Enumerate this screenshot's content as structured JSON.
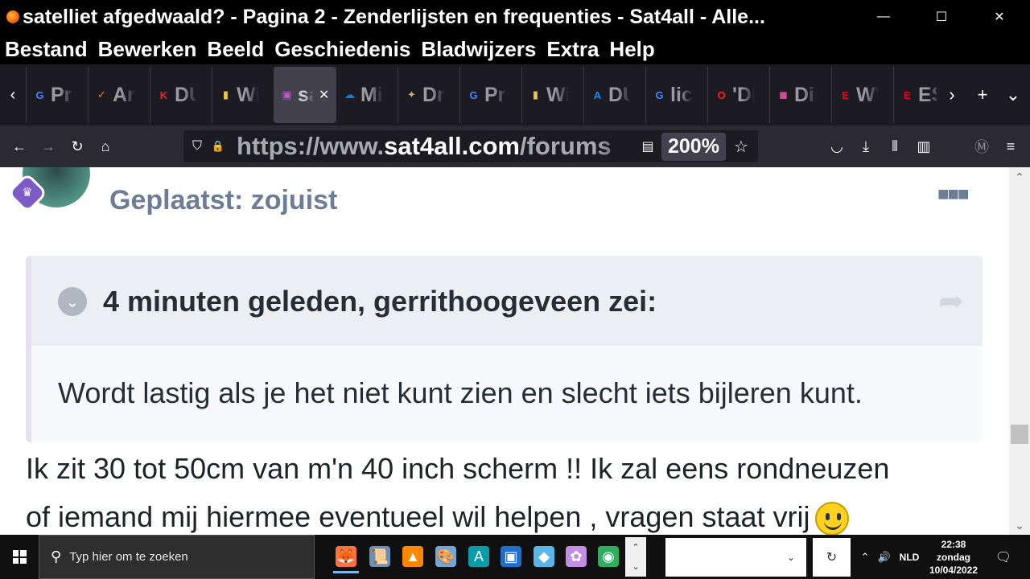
{
  "window": {
    "title": "satelliet afgedwaald? - Pagina 2 - Zenderlijsten en frequenties - Sat4all - Alle...",
    "minimize_glyph": "—",
    "maximize_glyph": "☐",
    "close_glyph": "✕"
  },
  "menu": {
    "items": [
      "Bestand",
      "Bewerken",
      "Beeld",
      "Geschiedenis",
      "Bladwijzers",
      "Extra",
      "Help"
    ]
  },
  "tabs": {
    "scroll_left": "‹",
    "scroll_right": "›",
    "new_tab": "+",
    "list_all": "⌄",
    "close_glyph": "✕",
    "items": [
      {
        "label": "Pr",
        "icon": "google-icon",
        "glyph": "G",
        "color": "#4285f4"
      },
      {
        "label": "Ar",
        "icon": "aliexpress-icon",
        "glyph": "✓",
        "color": "#ff7a00"
      },
      {
        "label": "DU",
        "icon": "kieskeurig-icon",
        "glyph": "K",
        "color": "#e52b2b"
      },
      {
        "label": "Wi",
        "icon": "folder-icon",
        "glyph": "▮",
        "color": "#e8c54a"
      },
      {
        "label": "sa",
        "icon": "tv-icon",
        "glyph": "▣",
        "color": "#c94fd1"
      },
      {
        "label": "Mi",
        "icon": "onedrive-icon",
        "glyph": "☁",
        "color": "#0f7fe0"
      },
      {
        "label": "Dr",
        "icon": "satellite-icon",
        "glyph": "✦",
        "color": "#c9b26b"
      },
      {
        "label": "Pr",
        "icon": "google-icon",
        "glyph": "G",
        "color": "#4285f4"
      },
      {
        "label": "Wi",
        "icon": "folder-icon",
        "glyph": "▮",
        "color": "#e8c54a"
      },
      {
        "label": "DU",
        "icon": "app-store-icon",
        "glyph": "A",
        "color": "#1a8ef0"
      },
      {
        "label": "lic",
        "icon": "google-icon",
        "glyph": "G",
        "color": "#4285f4"
      },
      {
        "label": "'Di",
        "icon": "opera-icon",
        "glyph": "O",
        "color": "#ff1b2d"
      },
      {
        "label": "Dis",
        "icon": "tile-icon",
        "glyph": "◼",
        "color": "#d24a8c"
      },
      {
        "label": "WV",
        "icon": "espn-icon",
        "glyph": "E",
        "color": "#e4002b"
      },
      {
        "label": "ES",
        "icon": "espn-icon",
        "glyph": "E",
        "color": "#e4002b"
      }
    ],
    "active_index": 4
  },
  "nav": {
    "back": "←",
    "forward": "→",
    "reload": "↻",
    "home": "⌂",
    "shield": "⛉",
    "lock": "🔒",
    "url_prefix": "https://www.",
    "url_host": "sat4all.com",
    "url_path": "/forums",
    "reader": "▤",
    "zoom": "200%",
    "star": "☆",
    "pocket": "◡",
    "download": "⤓",
    "library": "⫴",
    "sidebar": "▥",
    "account": "Ⓜ",
    "menu": "≡"
  },
  "post": {
    "posted_label": "Geplaatst: zojuist",
    "more_glyph": "■■■",
    "badge_glyph": "♛",
    "quote": {
      "chevron": "⌄",
      "citation": "4 minuten geleden, gerrithoogeveen zei:",
      "share_glyph": "➦",
      "text": "Wordt lastig als je het niet kunt zien en slecht iets bijleren kunt."
    },
    "line1": "Ik zit 30 tot 50cm van m'n 40 inch scherm !! Ik zal eens rondneuzen",
    "line2": "of iemand mij hiermee eventueel wil helpen , vragen staat vrij"
  },
  "scrollbar": {
    "up": "⌃",
    "down": "⌄",
    "position": 0.77
  },
  "taskbar": {
    "search_placeholder": "Typ hier om te zoeken",
    "search_glyph": "⚲",
    "apps": [
      {
        "name": "firefox",
        "glyph": "🦊",
        "bg": "#ff7139",
        "active": true
      },
      {
        "name": "notepad",
        "glyph": "📜",
        "bg": "#6b8fb5",
        "active": false
      },
      {
        "name": "vlc",
        "glyph": "▲",
        "bg": "#ff8800",
        "active": false
      },
      {
        "name": "paint",
        "glyph": "🎨",
        "bg": "#6fa7d8",
        "active": false
      },
      {
        "name": "arduino",
        "glyph": "A",
        "bg": "#0a9ca8",
        "active": false
      },
      {
        "name": "remote",
        "glyph": "▣",
        "bg": "#1f6fd1",
        "active": false
      },
      {
        "name": "sticky",
        "glyph": "◆",
        "bg": "#5bb6e8",
        "active": false
      },
      {
        "name": "flower",
        "glyph": "✿",
        "bg": "#c28fe3",
        "active": false
      },
      {
        "name": "edge",
        "glyph": "◉",
        "bg": "#2fae5f",
        "active": false
      }
    ],
    "stepper_up": "⌃",
    "stepper_down": "⌄",
    "dropdown": "⌄",
    "refresh": "↻",
    "tray_chevron": "⌃",
    "volume": "🔊",
    "language": "NLD",
    "time": "22:38",
    "day": "zondag",
    "date": "10/04/2022",
    "notification": "🗨"
  }
}
